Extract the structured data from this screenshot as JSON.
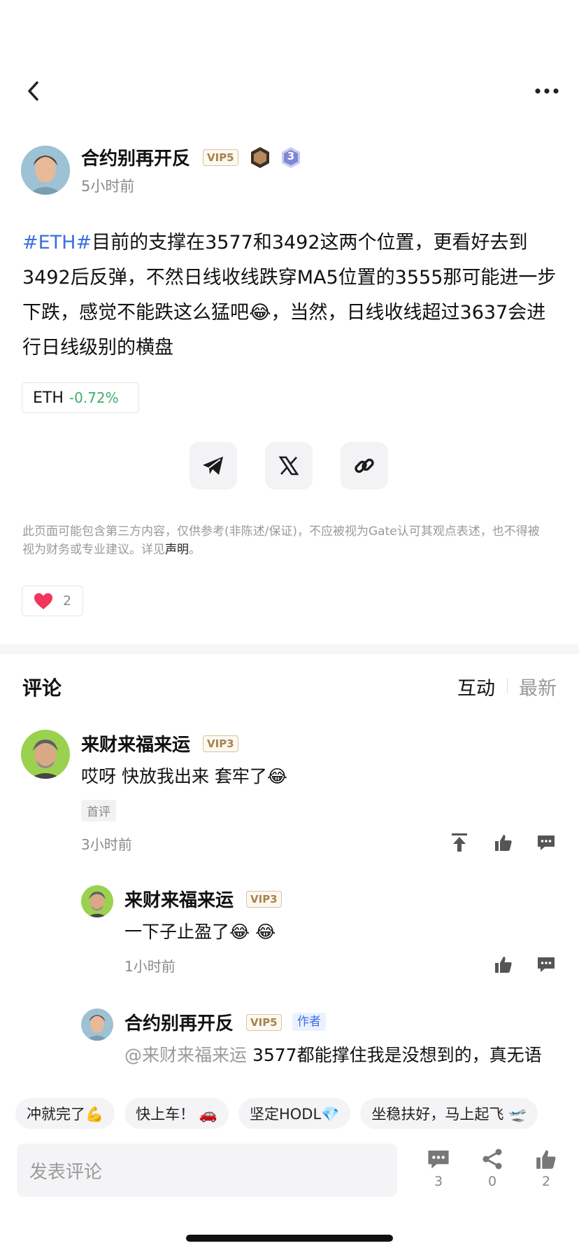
{
  "post": {
    "author": "合约别再开反",
    "vip": "VIP5",
    "level": "3",
    "time": "5小时前",
    "hashtag": "#ETH#",
    "content": "目前的支撑在3577和3492这两个位置，更看好去到3492后反弹，不然日线收线跌穿MA5位置的3555那可能进一步下跌，感觉不能跌这么猛吧😂，当然，日线收线超过3637会进行日线级别的横盘",
    "ticker": {
      "symbol": "ETH",
      "change": "-0.72%"
    },
    "disclaimer": "此页面可能包含第三方内容，仅供参考(非陈述/保证)，不应被视为Gate认可其观点表述，也不得被视为财务或专业建议。详见",
    "disclaimer_link": "声明",
    "disclaimer_end": "。",
    "likes": "2"
  },
  "comments_section": {
    "title": "评论",
    "sort_active": "互动",
    "sort_other": "最新"
  },
  "comments": [
    {
      "author": "来财来福来运",
      "vip": "VIP3",
      "text": "哎呀 快放我出来 套牢了😂",
      "badge": "首评",
      "time": "3小时前"
    },
    {
      "author": "来财来福来运",
      "vip": "VIP3",
      "text": "一下子止盈了😂 😂",
      "time": "1小时前"
    },
    {
      "author": "合约别再开反",
      "vip": "VIP5",
      "author_tag": "作者",
      "mention": "@来财来福来运",
      "text": "3577都能撑住我是没想到的，真无语"
    }
  ],
  "quick_replies": [
    "冲就完了💪",
    "快上车！ 🚗",
    "坚定HODL💎",
    "坐稳扶好，马上起飞 🛫"
  ],
  "footer": {
    "input_placeholder": "发表评论",
    "comments_count": "3",
    "shares_count": "0",
    "likes_count": "2"
  },
  "colors": {
    "accent_blue": "#3d6fe0",
    "change_green": "#3fae6a",
    "heart_red": "#f0365b"
  }
}
